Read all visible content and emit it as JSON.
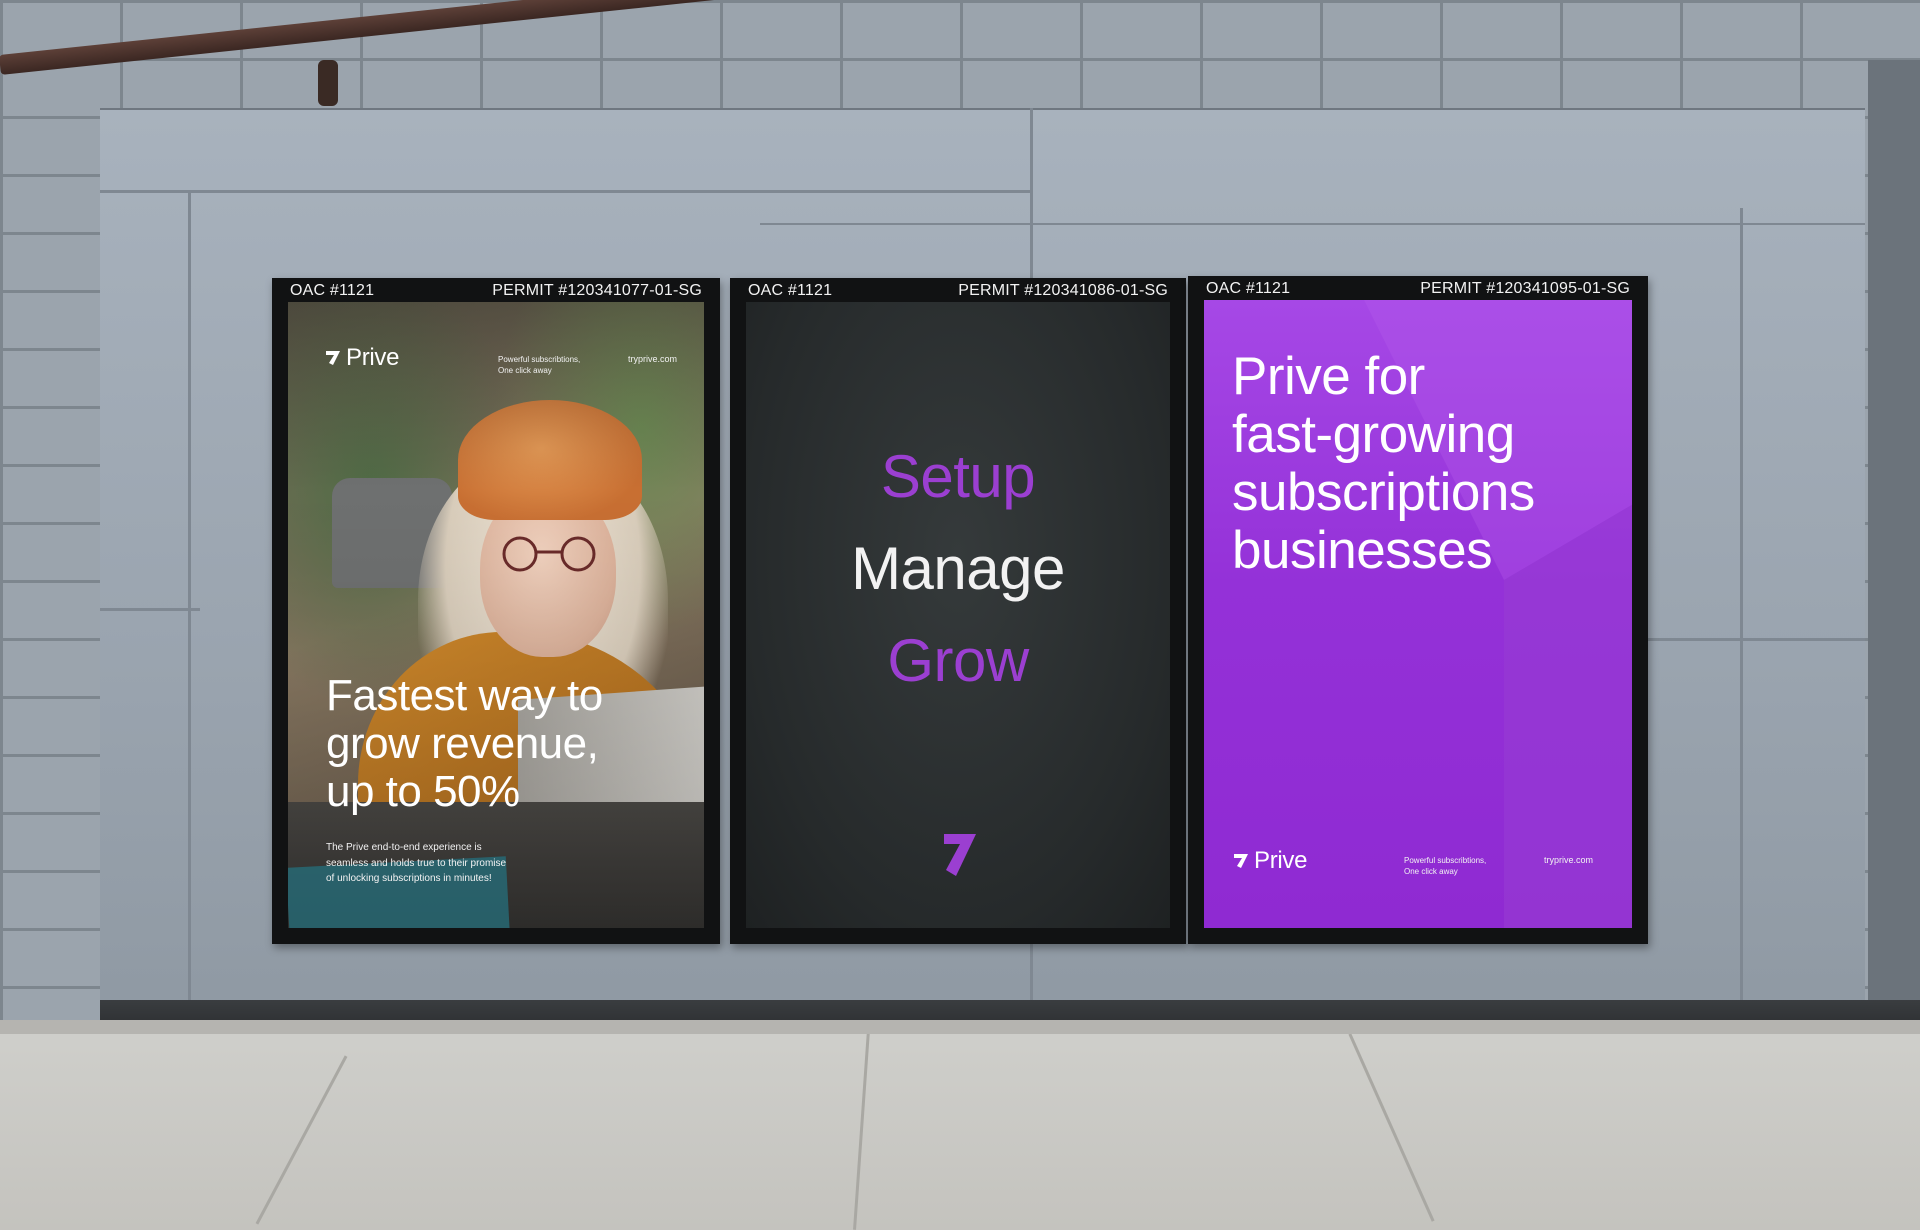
{
  "colors": {
    "brand_purple": "#9431d8",
    "accent_violet": "#9b3fd1",
    "poster_dark": "#262a2b",
    "text_white": "#ffffff"
  },
  "posters": [
    {
      "oac": "OAC #1121",
      "permit": "PERMIT #120341077-01-SG",
      "brand": "Prive",
      "tagline": [
        "Powerful subscribtions,",
        "One click away"
      ],
      "url": "tryprive.com",
      "headline": [
        "Fastest way to",
        "grow revenue,",
        "up to 50%"
      ],
      "body": [
        "The Prive end-to-end experience is",
        "seamless and holds true to their promise",
        "of unlocking subscriptions in minutes!"
      ]
    },
    {
      "oac": "OAC #1121",
      "permit": "PERMIT #120341086-01-SG",
      "words": [
        "Setup",
        "Manage",
        "Grow"
      ],
      "icon": "prive-arrow-icon"
    },
    {
      "oac": "OAC #1121",
      "permit": "PERMIT #120341095-01-SG",
      "headline": [
        "Prive for",
        "fast-growing",
        "subscriptions",
        "businesses"
      ],
      "brand": "Prive",
      "tagline": [
        "Powerful subscribtions,",
        "One click away"
      ],
      "url": "tryprive.com"
    }
  ]
}
